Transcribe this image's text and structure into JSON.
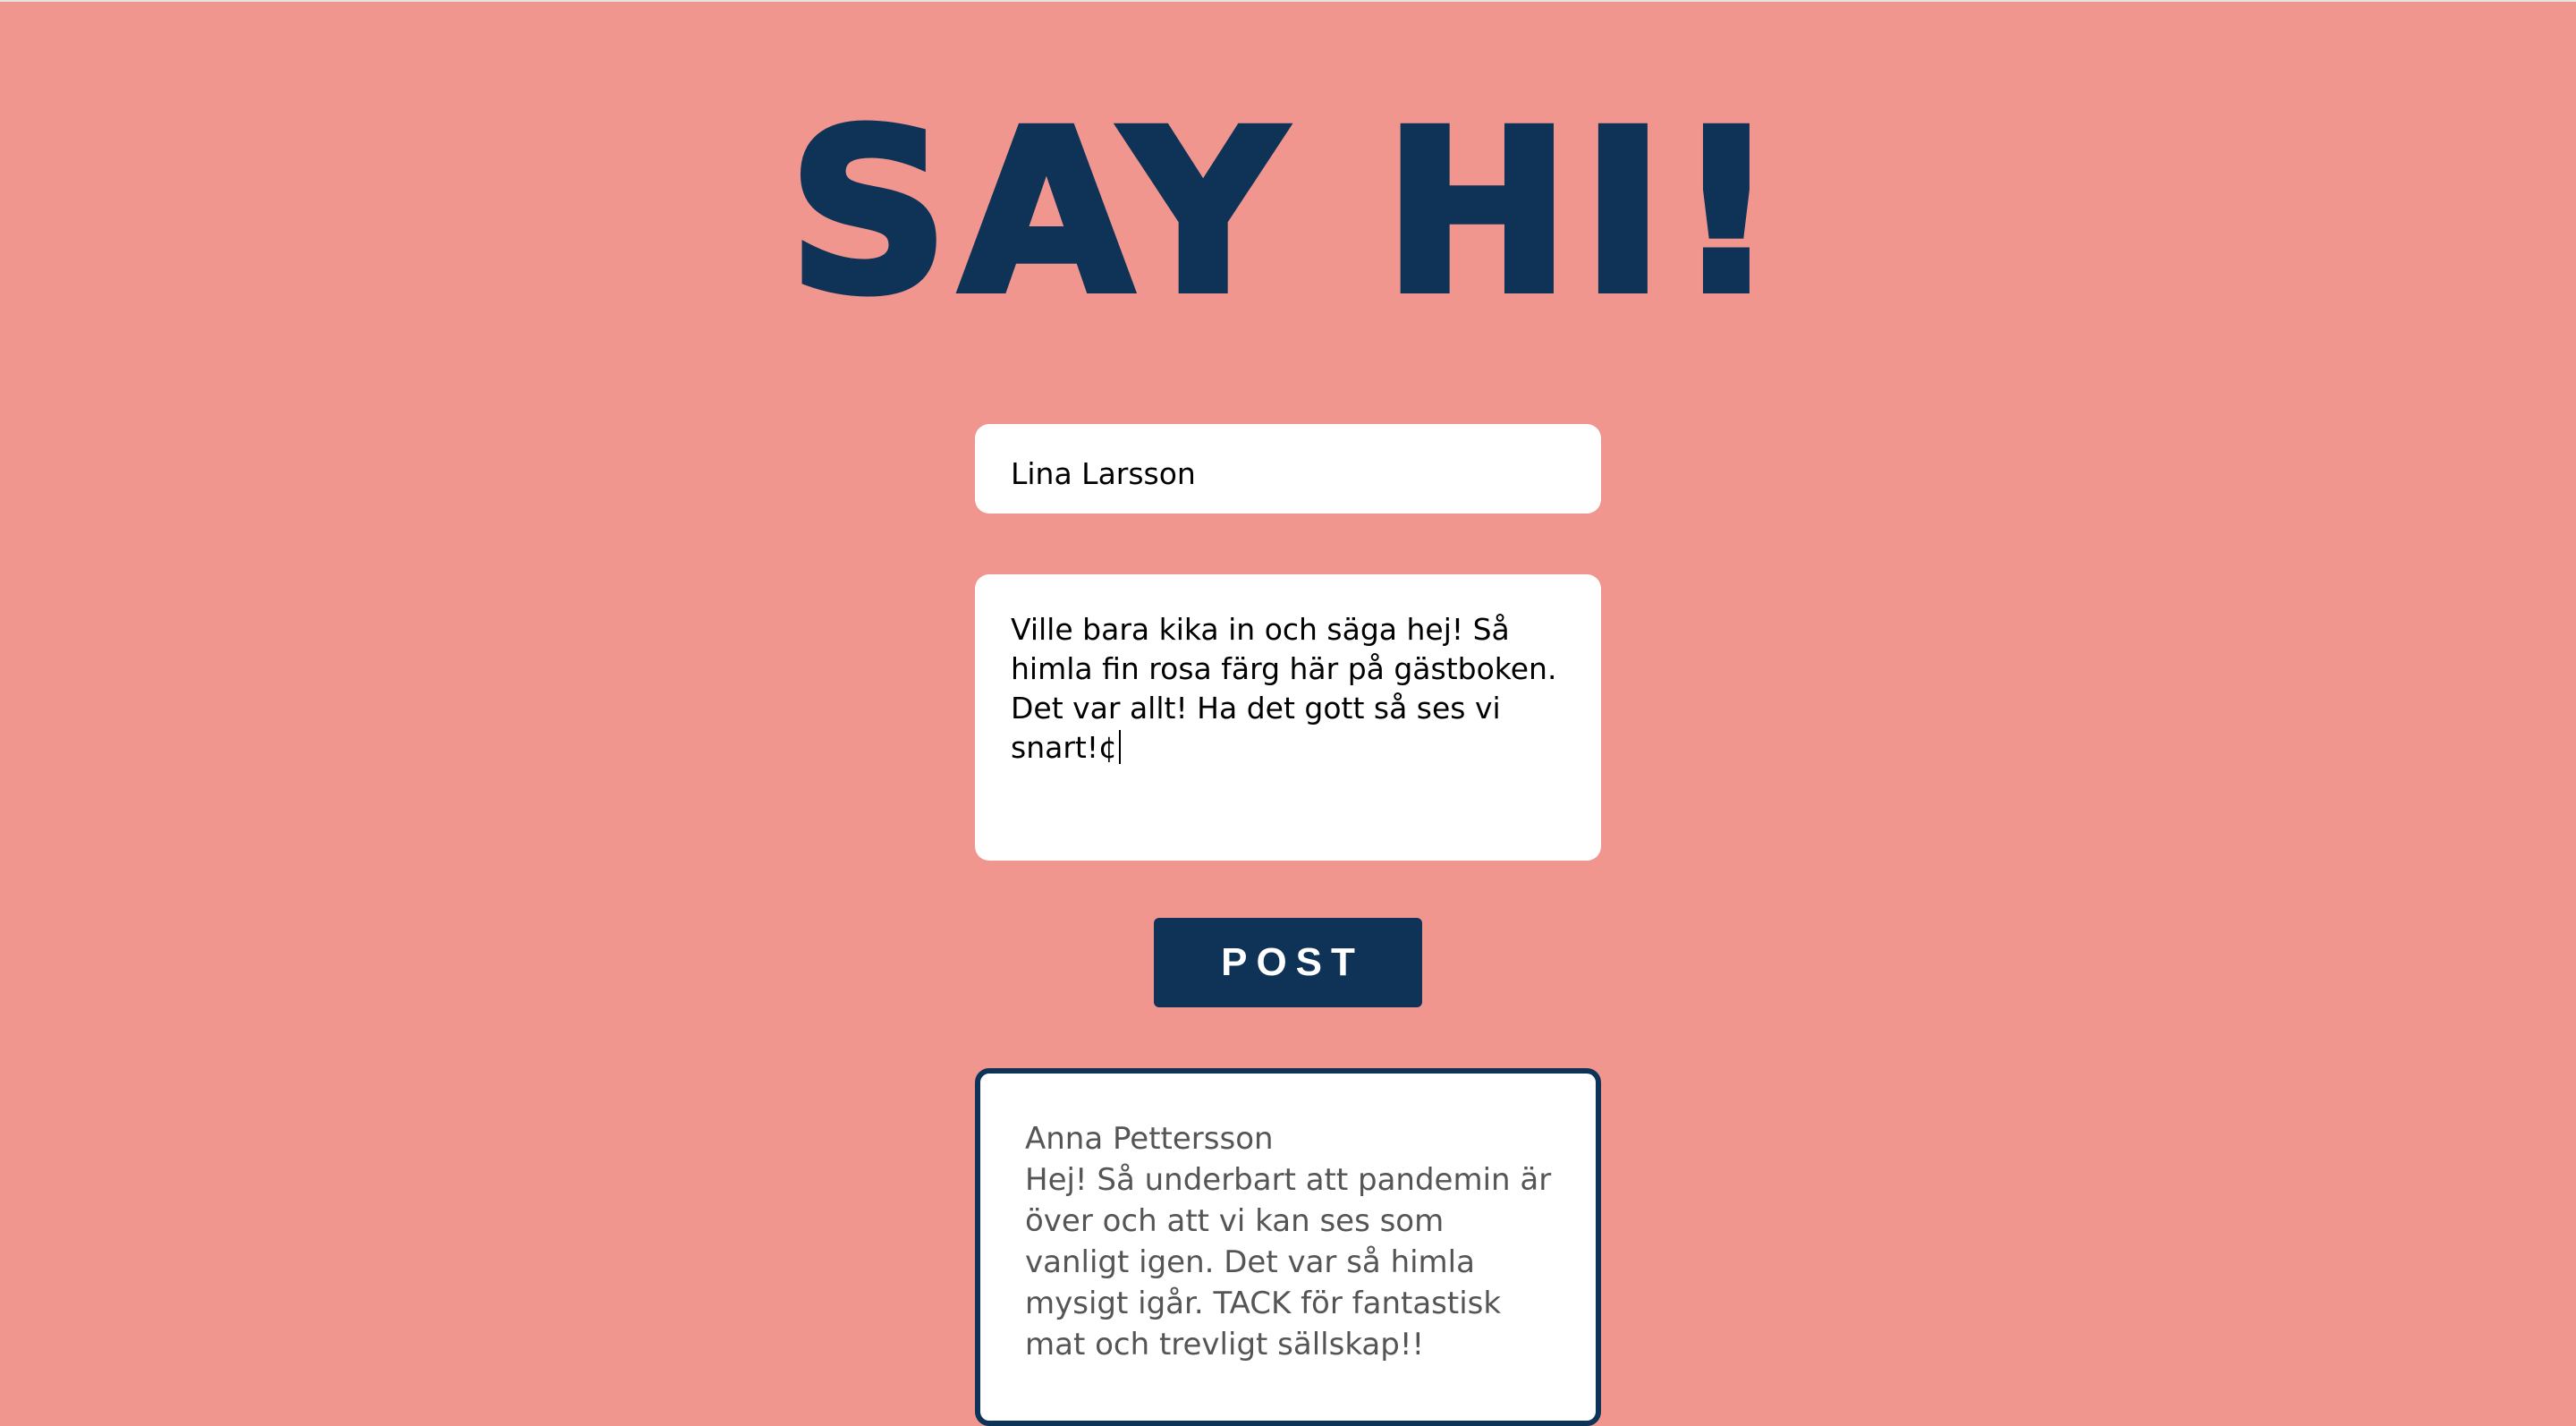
{
  "header": {
    "title": "SAY HI!"
  },
  "form": {
    "name_value": "Lina Larsson",
    "message_value": "Ville bara kika in och säga hej! Så himla fin rosa färg här på gästboken.\nDet var allt! Ha det gott så ses vi snart!¢",
    "post_label": "POST"
  },
  "entries": [
    {
      "author": "Anna Pettersson",
      "text": "Hej! Så underbart att pandemin är över och att vi kan ses som vanligt igen. Det var så himla mysigt igår. TACK för fantastisk mat och trevligt sällskap!!"
    }
  ],
  "colors": {
    "background": "#f0968f",
    "accent": "#0e3356",
    "field": "#ffffff"
  }
}
